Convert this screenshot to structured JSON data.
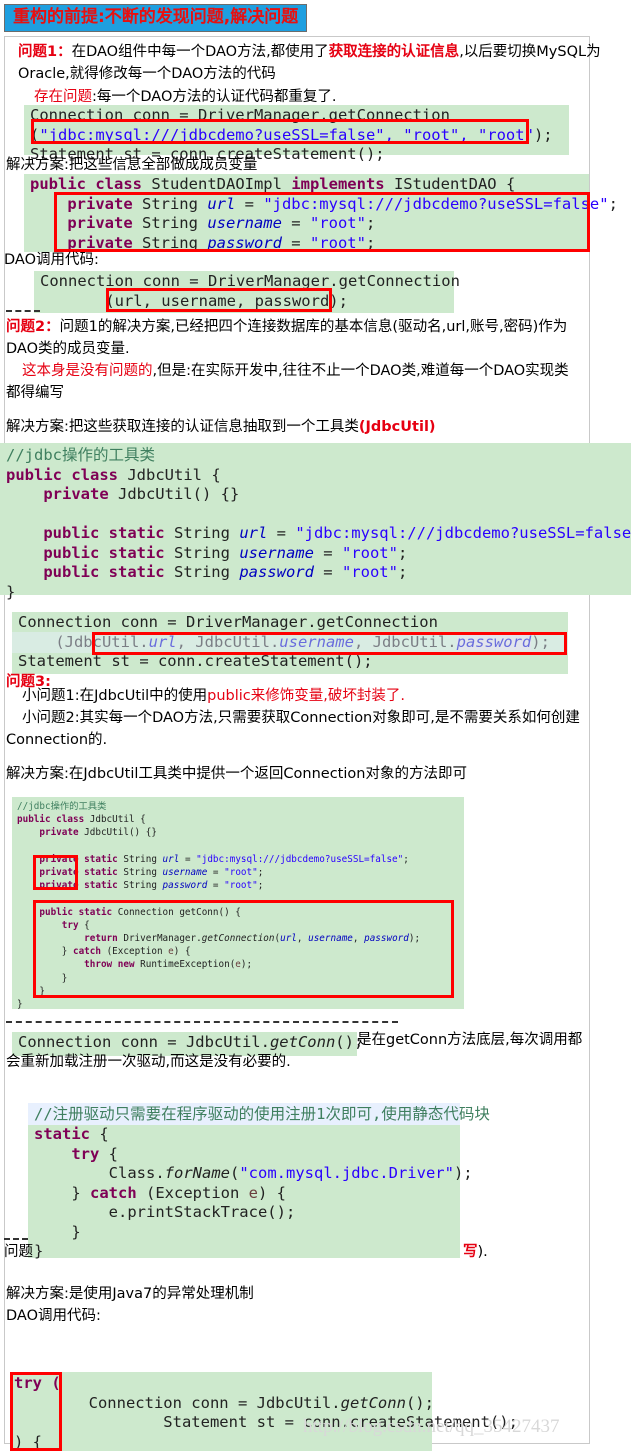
{
  "banner": {
    "text": "重构的前提:不断的发现问题,解决问题"
  },
  "sections": {
    "problem1": {
      "label": "问题1：",
      "line1_a": "在DAO组件中每一个DAO方法,都使用了",
      "line1_hl": "获取连接的认证信息",
      "line1_b": ",以后要切换MySQL为",
      "line2": "Oracle,就得修改每一个DAO方法的代码",
      "issue_label": "存在问题",
      "issue_text": ":每一个DAO方法的认证代码都重复了.",
      "solution": "解决方案:把这些信息全部做成成员变量",
      "dao_call_label": "DAO调用代码:"
    },
    "problem2": {
      "label": "问题2：",
      "line1": "问题1的解决方案,已经把四个连接数据库的基本信息(驱动名,url,账号,密码)作为",
      "line2": "DAO类的成员变量.",
      "line3_hl": "这本身是没有问题的",
      "line3_b": ",但是:在实际开发中,往往不止一个DAO类,难道每一个DAO实现类",
      "line4": "都得编写",
      "solution_a": "解决方案:把这些获取连接的认证信息抽取到一个工具类",
      "solution_hl": "(JdbcUtil)"
    },
    "problem3": {
      "label": "问题3:",
      "sub1_a": "小问题1:在JdbcUtil中的使用",
      "sub1_hl": "public来修饰变量,破坏封装了.",
      "sub2": "小问题2:其实每一个DAO方法,只需要获取Connection对象即可,是不需要关系如何创建",
      "sub3": "Connection的.",
      "solution": "解决方案:在JdbcUtil工具类中提供一个返回Connection对象的方法即可"
    },
    "problem4": {
      "label": "问题",
      "tail_hl": "写",
      "tail": ")."
    },
    "note_getconn": {
      "line1": "是在getConn方法底层,每次调用都",
      "line2": "会重新加载注册一次驱动,而这是没有必要的."
    },
    "final": {
      "solution": "解决方案:是使用Java7的异常处理机制",
      "dao_call_label": "DAO调用代码:"
    }
  },
  "code_blocks": {
    "block1": {
      "line1": "Connection conn = DriverManager.getConnection",
      "line2_prefix": "(",
      "line2_args": "\"jdbc:mysql:///jdbcdemo?useSSL=false\", \"root\", \"root\"",
      "line2_suffix": ");",
      "line3": "Statement st = conn.createStatement();"
    },
    "block2": {
      "line1": "public class StudentDAOImpl implements IStudentDAO {",
      "line2": "private String url = \"jdbc:mysql:///jdbcdemo?useSSL=false\";",
      "line3": "private String username = \"root\";",
      "line4": "private String password = \"root\";"
    },
    "block3": {
      "line1": "Connection conn = DriverManager.getConnection",
      "line2": "(url, username, password);"
    },
    "block4": {
      "comment": "//jdbc操作的工具类",
      "line1": "public class JdbcUtil {",
      "line2": "    private JdbcUtil() {}",
      "line3": "",
      "line4": "    public static String url = \"jdbc:mysql:///jdbcdemo?useSSL=false\";",
      "line5": "    public static String username = \"root\";",
      "line6": "    public static String password = \"root\";",
      "line7": "}"
    },
    "block5": {
      "line1": "Connection conn = DriverManager.getConnection",
      "line2": "(JdbcUtil.url, JdbcUtil.username, JdbcUtil.password);",
      "line3": "Statement st = conn.createStatement();"
    },
    "block6": {
      "comment": "//jdbc操作的工具类",
      "l1": "public class JdbcUtil {",
      "l2": "    private JdbcUtil() {}",
      "l3": "",
      "l4": "    private static String url = \"jdbc:mysql:///jdbcdemo?useSSL=false\";",
      "l5": "    private static String username = \"root\";",
      "l6": "    private static String password = \"root\";",
      "l7": "",
      "l8": "    public static Connection getConn() {",
      "l9": "        try {",
      "l10": "            return DriverManager.getConnection(url, username, password);",
      "l11": "        } catch (Exception e) {",
      "l12": "            throw new RuntimeException(e);",
      "l13": "        }",
      "l14": "    }",
      "l15": "}"
    },
    "block7": {
      "line1": "Connection conn = JdbcUtil.getConn();"
    },
    "block8": {
      "comment": "//注册驱动只需要在程序驱动的使用注册1次即可,使用静态代码块",
      "l1": "static {",
      "l2": "    try {",
      "l3": "        Class.forName(\"com.mysql.jdbc.Driver\");",
      "l4": "    } catch (Exception e) {",
      "l5": "        e.printStackTrace();",
      "l6": "    }",
      "l7": "}"
    },
    "block9": {
      "l1": "try (",
      "l2": "        Connection conn = JdbcUtil.getConn();",
      "l3": "        Statement st = conn.createStatement();",
      "l4": ") {"
    }
  },
  "watermark": {
    "text": "http://blog.csdn.net/qq_35427437"
  },
  "colors": {
    "banner_bg": "#1E9FE0",
    "banner_fg": "#E81010",
    "code_bg": "#CDE9CD",
    "highlight_box": "#FF0000",
    "keyword": "#7F0055",
    "string": "#2A00FF",
    "comment": "#3F7F5F",
    "field": "#0000C0"
  }
}
